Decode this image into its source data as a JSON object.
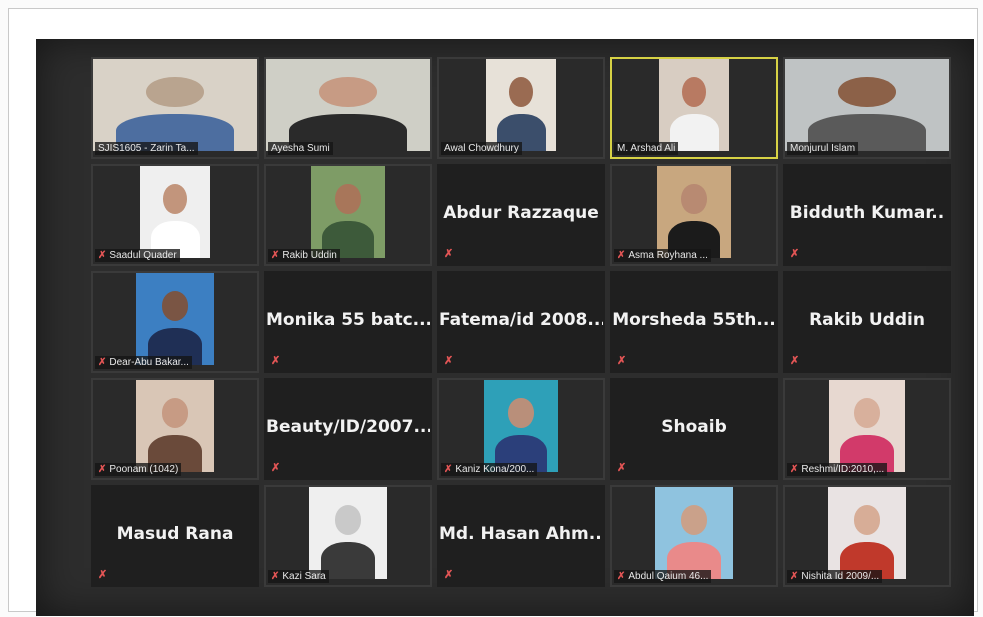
{
  "meeting": {
    "participants": [
      {
        "name": "SJIS1605 - Zarin Ta...",
        "type": "video",
        "muted": false,
        "active": false,
        "tone": "#b9a48f",
        "shirt": "#4d6ea0",
        "bg": "#d9d2c7",
        "photo_w": 168
      },
      {
        "name": "Ayesha Sumi",
        "type": "video",
        "muted": false,
        "active": false,
        "tone": "#c79b84",
        "shirt": "#2a2a2a",
        "bg": "#cfcfc6",
        "photo_w": 168
      },
      {
        "name": "Awal Chowdhury",
        "type": "video",
        "muted": false,
        "active": false,
        "tone": "#9a6b52",
        "shirt": "#3b4e6b",
        "bg": "#e7e1d8",
        "photo_w": 70
      },
      {
        "name": "M. Arshad Ali",
        "type": "video",
        "muted": false,
        "active": true,
        "tone": "#b87a62",
        "shirt": "#f2f2f2",
        "bg": "#d8cdc2",
        "photo_w": 70
      },
      {
        "name": "Monjurul Islam",
        "type": "video",
        "muted": false,
        "active": false,
        "tone": "#8c6148",
        "shirt": "#5a5a5a",
        "bg": "#bfc3c4",
        "photo_w": 168
      },
      {
        "name": "Saadul Quader",
        "type": "video",
        "muted": true,
        "active": false,
        "tone": "#c2957c",
        "shirt": "#ffffff",
        "bg": "#efefef",
        "photo_w": 70
      },
      {
        "name": "Rakib Uddin",
        "type": "video",
        "muted": true,
        "active": false,
        "tone": "#a8765a",
        "shirt": "#3d5a3a",
        "bg": "#7e9c66",
        "photo_w": 74
      },
      {
        "name": "Abdur Razzaque",
        "type": "name",
        "muted": true,
        "active": false
      },
      {
        "name": "Asma Royhana ...",
        "type": "video",
        "muted": true,
        "active": false,
        "tone": "#b88a72",
        "shirt": "#1b1b1b",
        "bg": "#c8a77f",
        "photo_w": 74
      },
      {
        "name": "Bidduth Kumar..",
        "type": "name",
        "muted": true,
        "active": false
      },
      {
        "name": "Dear-Abu Bakar...",
        "type": "video",
        "muted": true,
        "active": false,
        "tone": "#7a5544",
        "shirt": "#1f2f55",
        "bg": "#3c7fc2",
        "photo_w": 78
      },
      {
        "name": "Monika 55 batc...",
        "type": "name",
        "muted": true,
        "active": false
      },
      {
        "name": "Fatema/id 2008...",
        "type": "name",
        "muted": true,
        "active": false
      },
      {
        "name": "Morsheda 55th...",
        "type": "name",
        "muted": true,
        "active": false
      },
      {
        "name": "Rakib Uddin",
        "type": "name",
        "muted": true,
        "active": false
      },
      {
        "name": "Poonam (1042)",
        "type": "video",
        "muted": true,
        "active": false,
        "tone": "#c79b84",
        "shirt": "#6a4a3a",
        "bg": "#d9c6b6",
        "photo_w": 78
      },
      {
        "name": "Beauty/ID/2007...",
        "type": "name",
        "muted": true,
        "active": false
      },
      {
        "name": "Kaniz Kona/200...",
        "type": "video",
        "muted": true,
        "active": false,
        "tone": "#b98f7a",
        "shirt": "#2b3f7a",
        "bg": "#2ea0b8",
        "photo_w": 74
      },
      {
        "name": "Shoaib",
        "type": "name",
        "muted": true,
        "active": false
      },
      {
        "name": "Reshmi/ID:2010,...",
        "type": "video",
        "muted": true,
        "active": false,
        "tone": "#d8b09c",
        "shirt": "#d23a6a",
        "bg": "#e7d8d0",
        "photo_w": 76
      },
      {
        "name": "Masud Rana",
        "type": "name",
        "muted": true,
        "active": false
      },
      {
        "name": "Kazi Sara",
        "type": "video",
        "muted": true,
        "active": false,
        "tone": "#c9c9c9",
        "shirt": "#3a3a3a",
        "bg": "#efefef",
        "photo_w": 78
      },
      {
        "name": "Md. Hasan Ahm...",
        "type": "name",
        "muted": true,
        "active": false
      },
      {
        "name": "Abdul Qaium 46...",
        "type": "video",
        "muted": true,
        "active": false,
        "tone": "#caa18a",
        "shirt": "#e98a8a",
        "bg": "#8fc3df",
        "photo_w": 78
      },
      {
        "name": "Nishita Id 2009/...",
        "type": "video",
        "muted": true,
        "active": false,
        "tone": "#d7ad97",
        "shirt": "#c0392b",
        "bg": "#e9e3e3",
        "photo_w": 78
      }
    ],
    "mic_icon_glyph": "✗",
    "mic_icon": "muted-mic-icon"
  }
}
